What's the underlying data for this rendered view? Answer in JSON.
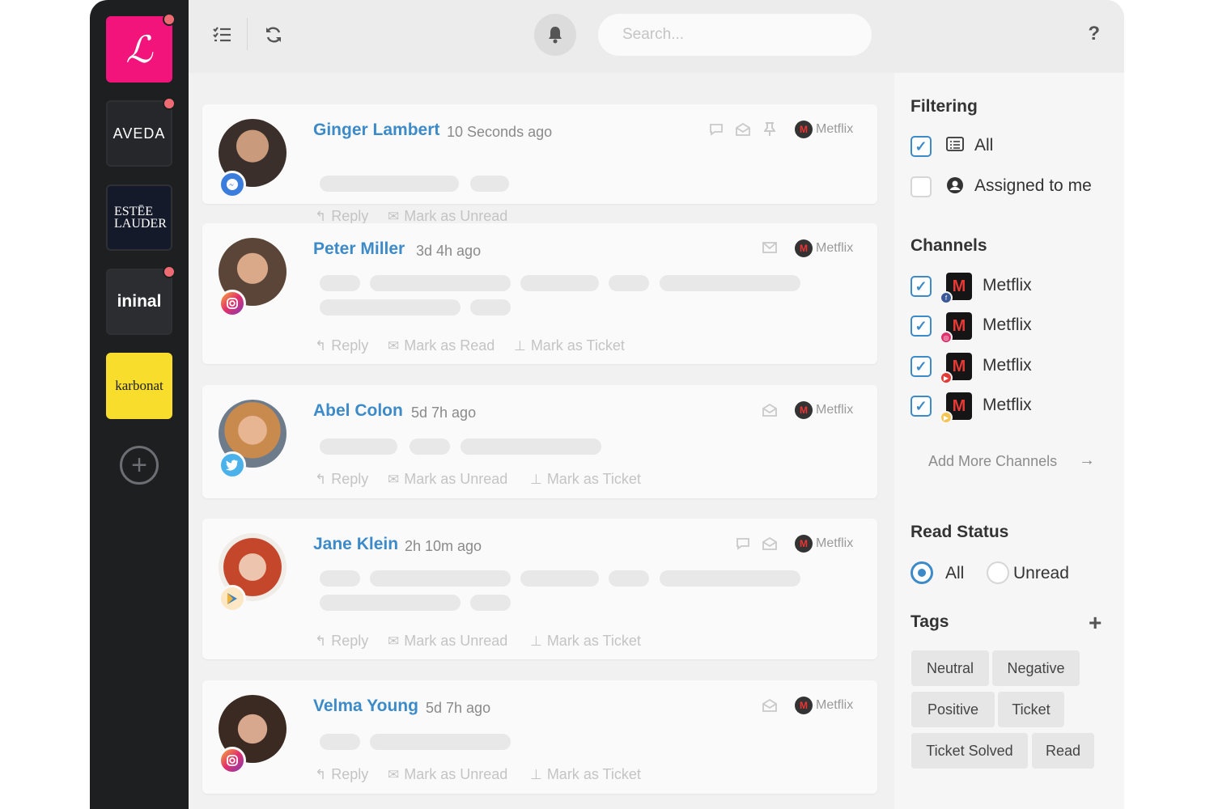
{
  "brands": [
    {
      "name": "L",
      "logo_text": "ℒ",
      "has_notification": true
    },
    {
      "name": "AVEDA",
      "logo_text": "AVEDA",
      "has_notification": true
    },
    {
      "name": "ESTĒE LAUDER",
      "logo_text": "ESTĒE LAUDER",
      "has_notification": false
    },
    {
      "name": "ininal",
      "logo_text": "ininal",
      "has_notification": true
    },
    {
      "name": "karbonat",
      "logo_text": "karbonat",
      "has_notification": false
    }
  ],
  "topbar": {
    "search_placeholder": "Search...",
    "help_label": "?"
  },
  "messages": [
    {
      "name": "Ginger Lambert",
      "time": "10 Seconds ago",
      "brand": "Metflix",
      "channel": "messenger",
      "actions": [
        "Reply",
        "Mark as Unread"
      ]
    },
    {
      "name": "Peter Miller",
      "time": "3d 4h ago",
      "brand": "Metflix",
      "channel": "instagram",
      "actions": [
        "Reply",
        "Mark as Read",
        "Mark as Ticket"
      ]
    },
    {
      "name": "Abel Colon",
      "time": "5d 7h ago",
      "brand": "Metflix",
      "channel": "twitter",
      "actions": [
        "Reply",
        "Mark as Unread",
        "Mark as Ticket"
      ]
    },
    {
      "name": "Jane Klein",
      "time": "2h 10m ago",
      "brand": "Metflix",
      "channel": "play-store",
      "actions": [
        "Reply",
        "Mark as Unread",
        "Mark as Ticket"
      ]
    },
    {
      "name": "Velma Young",
      "time": "5d 7h ago",
      "brand": "Metflix",
      "channel": "instagram",
      "actions": [
        "Reply",
        "Mark as Unread",
        "Mark as Ticket"
      ]
    }
  ],
  "panel": {
    "filtering": {
      "title": "Filtering",
      "options": [
        {
          "label": "All",
          "checked": true
        },
        {
          "label": "Assigned to me",
          "checked": false
        }
      ]
    },
    "channels": {
      "title": "Channels",
      "items": [
        {
          "label": "Metflix",
          "network": "facebook",
          "checked": true
        },
        {
          "label": "Metflix",
          "network": "instagram",
          "checked": true
        },
        {
          "label": "Metflix",
          "network": "youtube",
          "checked": true
        },
        {
          "label": "Metflix",
          "network": "play-store",
          "checked": true
        }
      ],
      "add_more": "Add More Channels"
    },
    "read_status": {
      "title": "Read Status",
      "options": [
        {
          "label": "All",
          "selected": true
        },
        {
          "label": "Unread",
          "selected": false
        }
      ]
    },
    "tags": {
      "title": "Tags",
      "items": [
        "Neutral",
        "Negative",
        "Positive",
        "Ticket",
        "Ticket Solved",
        "Read"
      ]
    }
  },
  "colors": {
    "accent": "#3d8ac9",
    "sidebar": "#1d1f21",
    "notification_dot": "#ef6b73",
    "brand_pink": "#f2147a",
    "brand_yellow": "#f8dd2c"
  }
}
